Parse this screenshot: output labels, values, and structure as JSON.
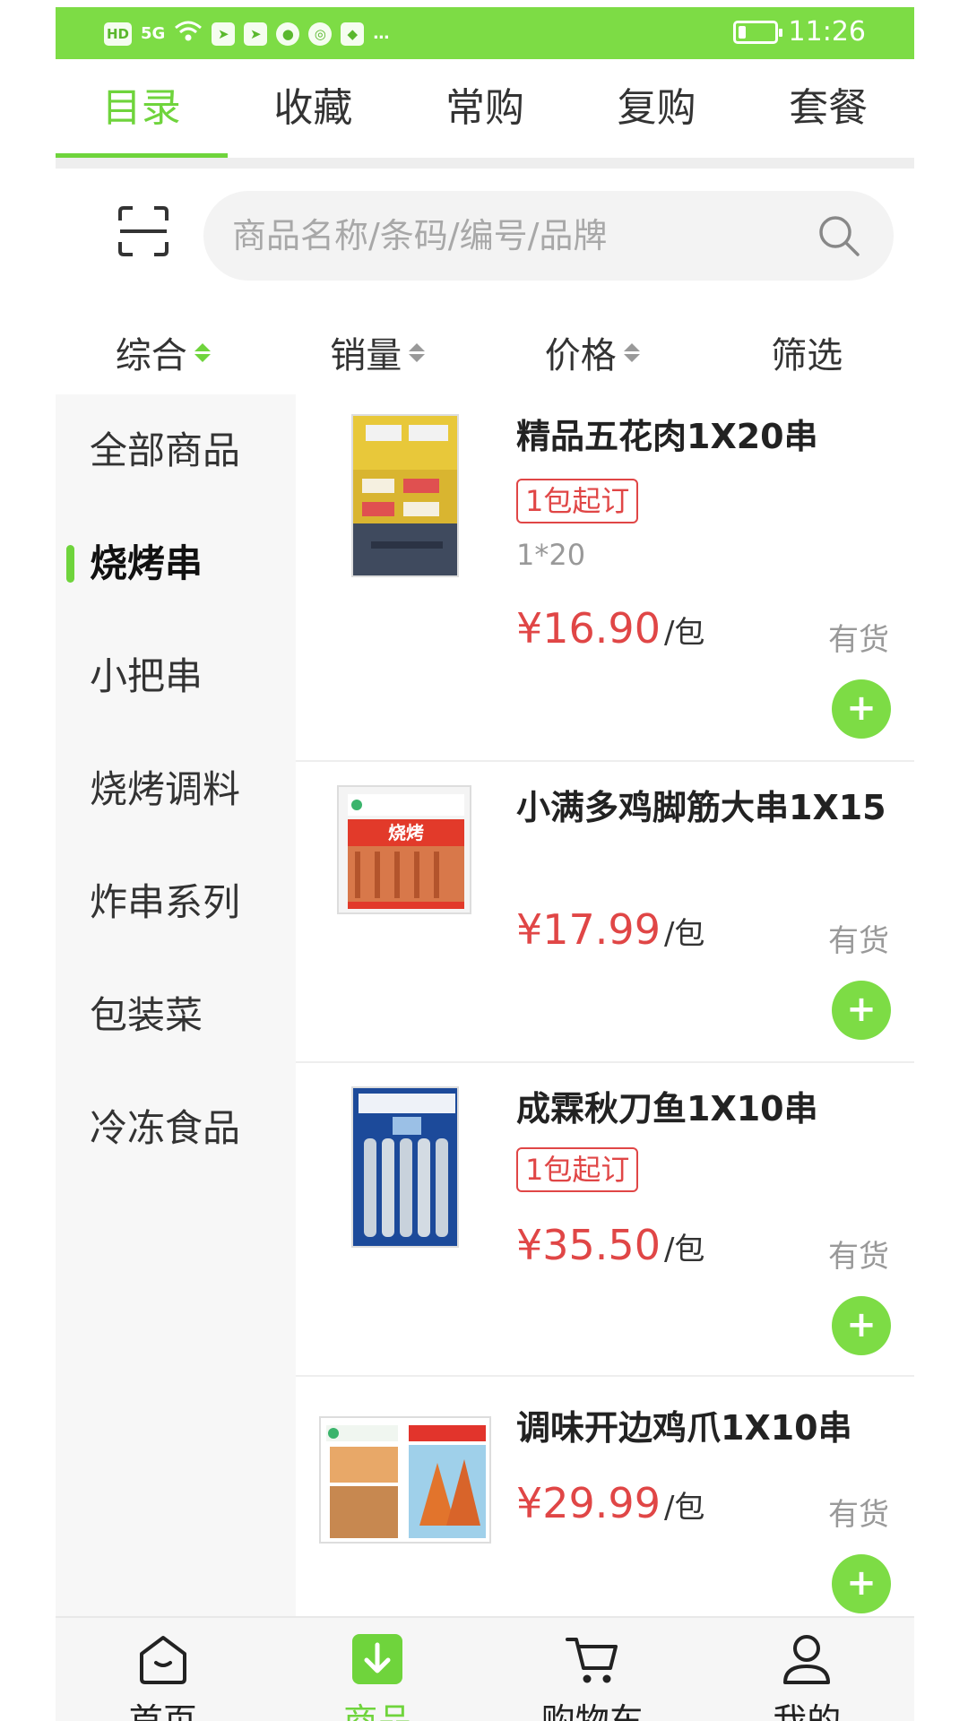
{
  "status_bar": {
    "left_icons": [
      "HD",
      "5G",
      "wifi-icon",
      "telegram-icon",
      "telegram-icon",
      "app-icon",
      "app-icon",
      "app-icon",
      "…"
    ],
    "time": "11:26",
    "battery_level": 0.2
  },
  "top_tabs": [
    {
      "label": "目录",
      "active": true
    },
    {
      "label": "收藏",
      "active": false
    },
    {
      "label": "常购",
      "active": false
    },
    {
      "label": "复购",
      "active": false
    },
    {
      "label": "套餐",
      "active": false
    }
  ],
  "search": {
    "placeholder": "商品名称/条码/编号/品牌",
    "value": "",
    "scan_icon": "scan-icon",
    "search_icon": "search-icon"
  },
  "sort": [
    {
      "label": "综合",
      "has_arrows": true,
      "active": true
    },
    {
      "label": "销量",
      "has_arrows": true,
      "active": false
    },
    {
      "label": "价格",
      "has_arrows": true,
      "active": false
    },
    {
      "label": "筛选",
      "has_arrows": false,
      "active": false
    }
  ],
  "categories": [
    {
      "label": "全部商品",
      "active": false
    },
    {
      "label": "烧烤串",
      "active": true
    },
    {
      "label": "小把串",
      "active": false
    },
    {
      "label": "烧烤调料",
      "active": false
    },
    {
      "label": "炸串系列",
      "active": false
    },
    {
      "label": "包装菜",
      "active": false
    },
    {
      "label": "冷冻食品",
      "active": false
    }
  ],
  "products": [
    {
      "name": "精品五花肉1X20串",
      "tag": "1包起订",
      "spec": "1*20",
      "price": "¥16.90",
      "unit": "/包",
      "stock": "有货",
      "add": "+"
    },
    {
      "name": "小满多鸡脚筋大串1X15",
      "tag": "",
      "spec": "",
      "price": "¥17.99",
      "unit": "/包",
      "stock": "有货",
      "add": "+"
    },
    {
      "name": "成霖秋刀鱼1X10串",
      "tag": "1包起订",
      "spec": "",
      "price": "¥35.50",
      "unit": "/包",
      "stock": "有货",
      "add": "+"
    },
    {
      "name": "调味开边鸡爪1X10串",
      "tag": "",
      "spec": "",
      "price": "¥29.99",
      "unit": "/包",
      "stock": "有货",
      "add": "+"
    }
  ],
  "bottom_nav": [
    {
      "label": "首页",
      "icon": "home-icon",
      "active": false
    },
    {
      "label": "商品",
      "icon": "goods-icon",
      "active": true
    },
    {
      "label": "购物车",
      "icon": "cart-icon",
      "active": false
    },
    {
      "label": "我的",
      "icon": "user-icon",
      "active": false
    }
  ],
  "colors": {
    "accent": "#6fd43c",
    "status_bar": "#7ddc45",
    "price": "#e04646",
    "sidebar_bg": "#f7f7f7"
  }
}
